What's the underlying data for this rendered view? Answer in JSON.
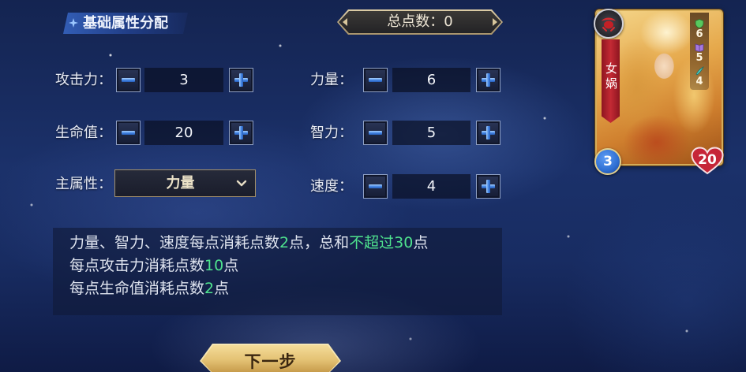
{
  "header": {
    "title": "基础属性分配",
    "icon": "diamond-star-icon"
  },
  "total_points": {
    "label": "总点数：",
    "value": "0"
  },
  "icons": {
    "decrease": "minus-icon",
    "increase": "plus-icon"
  },
  "attributes_left": [
    {
      "label": "攻击力：",
      "value": "3"
    },
    {
      "label": "生命值：",
      "value": "20"
    }
  ],
  "main_attribute": {
    "label": "主属性：",
    "selected": "力量",
    "icon": "chevron-down-icon"
  },
  "attributes_right": [
    {
      "label": "力量：",
      "value": "6"
    },
    {
      "label": "智力：",
      "value": "5"
    },
    {
      "label": "速度：",
      "value": "4"
    }
  ],
  "info": {
    "lines": [
      [
        {
          "text": "力量、智力、速度每点消耗点数",
          "highlight": false
        },
        {
          "text": "2",
          "highlight": true
        },
        {
          "text": "点，总和",
          "highlight": false
        },
        {
          "text": "不超过30",
          "highlight": true
        },
        {
          "text": "点",
          "highlight": false
        }
      ],
      [
        {
          "text": "每点攻击力消耗点数",
          "highlight": false
        },
        {
          "text": "10",
          "highlight": true
        },
        {
          "text": "点",
          "highlight": false
        }
      ],
      [
        {
          "text": "每点生命值消耗点数",
          "highlight": false
        },
        {
          "text": "2",
          "highlight": true
        },
        {
          "text": "点",
          "highlight": false
        }
      ]
    ]
  },
  "next_button": {
    "label": "下一步"
  },
  "card": {
    "name": "女娲",
    "attack": "3",
    "hp": "20",
    "emblem_icon": "faction-emblem-icon",
    "stats": [
      {
        "icon": "strength-icon",
        "value": "6"
      },
      {
        "icon": "intellect-icon",
        "value": "5"
      },
      {
        "icon": "speed-icon",
        "value": "4"
      }
    ]
  },
  "colors": {
    "highlight": "#4fe38e",
    "text": "#dfe4ef",
    "button_gold": "#e4c274",
    "hp_red": "#c62638",
    "attack_blue": "#2f6fd2"
  }
}
